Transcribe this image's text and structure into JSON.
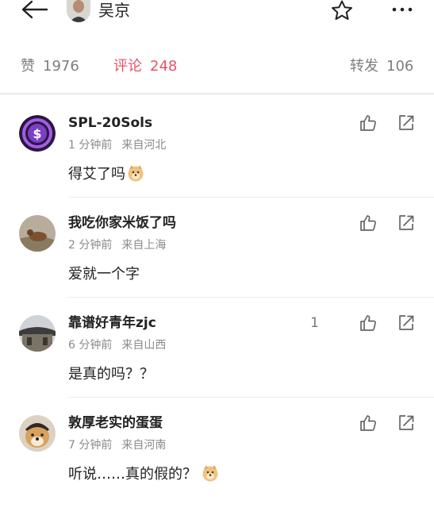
{
  "header": {
    "title": "吴京",
    "icons": [
      "back-arrow-icon",
      "avatar",
      "star-icon",
      "more-icon"
    ]
  },
  "stats": {
    "likes_label": "赞",
    "likes_count": "1976",
    "comments_label": "评论",
    "comments_count": "248",
    "reposts_label": "转发",
    "reposts_count": "106",
    "active_color": "#e45366"
  },
  "comments": [
    {
      "user": "SPL-20Sols",
      "time": "1 分钟前",
      "location": "来自河北",
      "text": "得艾了吗",
      "emoji": "doge-emoji",
      "likes": ""
    },
    {
      "user": "我吃你家米饭了吗",
      "time": "2 分钟前",
      "location": "来自上海",
      "text": "爱就一个字",
      "emoji": "",
      "likes": ""
    },
    {
      "user": "靠谱好青年zjc",
      "time": "6 分钟前",
      "location": "来自山西",
      "text": "是真的吗？？",
      "emoji": "",
      "likes": "1"
    },
    {
      "user": "敦厚老实的蛋蛋",
      "time": "7 分钟前",
      "location": "来自河南",
      "text": "听说……真的假的？",
      "emoji": "doge-emoji",
      "likes": ""
    }
  ]
}
